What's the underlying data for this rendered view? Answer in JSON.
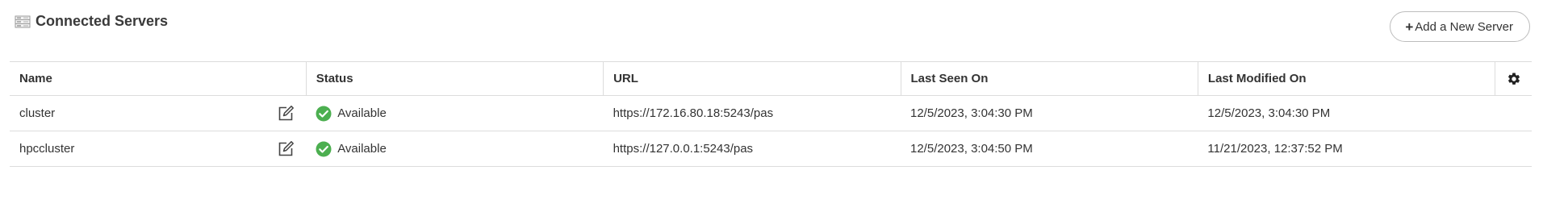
{
  "header": {
    "title": "Connected Servers",
    "icon": "servers-icon"
  },
  "toolbar": {
    "add_label": "Add a New Server",
    "add_icon": "plus-icon"
  },
  "table": {
    "columns": [
      "Name",
      "Status",
      "URL",
      "Last Seen On",
      "Last Modified On"
    ],
    "settings_icon": "gear-icon",
    "rows": [
      {
        "name": "cluster",
        "status": "Available",
        "url": "https://172.16.80.18:5243/pas",
        "last_seen": "12/5/2023, 3:04:30 PM",
        "last_modified": "12/5/2023, 3:04:30 PM"
      },
      {
        "name": "hpccluster",
        "status": "Available",
        "url": "https://127.0.0.1:5243/pas",
        "last_seen": "12/5/2023, 3:04:50 PM",
        "last_modified": "11/21/2023, 12:37:52 PM"
      }
    ]
  },
  "colors": {
    "status_ok": "#4caf50",
    "border": "#dcdcdc",
    "text": "#333333"
  }
}
